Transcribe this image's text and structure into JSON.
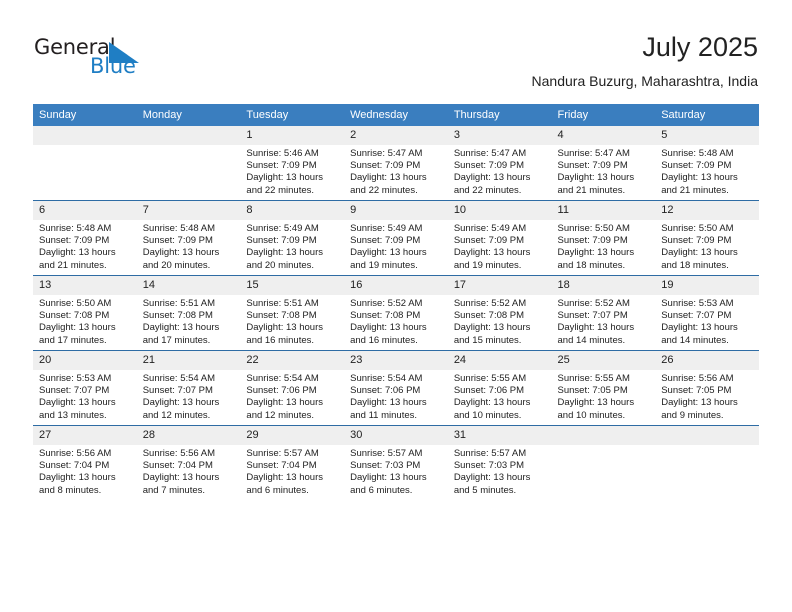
{
  "brand": {
    "name_part1": "General",
    "name_part2": "Blue",
    "triangle_color": "#1f7ec4",
    "text_color": "#231f20"
  },
  "header": {
    "month_title": "July 2025",
    "location": "Nandura Buzurg, Maharashtra, India"
  },
  "theme": {
    "header_blue": "#3a7ebf",
    "row_divider_blue": "#2e6ca4",
    "daynum_band": "#efefef",
    "text": "#222222"
  },
  "weekdays": [
    "Sunday",
    "Monday",
    "Tuesday",
    "Wednesday",
    "Thursday",
    "Friday",
    "Saturday"
  ],
  "weeks": [
    [
      {
        "day": "",
        "sunrise": "",
        "sunset": "",
        "daylight_line1": "",
        "daylight_line2": "",
        "blank": true
      },
      {
        "day": "",
        "sunrise": "",
        "sunset": "",
        "daylight_line1": "",
        "daylight_line2": "",
        "blank": true
      },
      {
        "day": "1",
        "sunrise": "Sunrise: 5:46 AM",
        "sunset": "Sunset: 7:09 PM",
        "daylight_line1": "Daylight: 13 hours",
        "daylight_line2": "and 22 minutes."
      },
      {
        "day": "2",
        "sunrise": "Sunrise: 5:47 AM",
        "sunset": "Sunset: 7:09 PM",
        "daylight_line1": "Daylight: 13 hours",
        "daylight_line2": "and 22 minutes."
      },
      {
        "day": "3",
        "sunrise": "Sunrise: 5:47 AM",
        "sunset": "Sunset: 7:09 PM",
        "daylight_line1": "Daylight: 13 hours",
        "daylight_line2": "and 22 minutes."
      },
      {
        "day": "4",
        "sunrise": "Sunrise: 5:47 AM",
        "sunset": "Sunset: 7:09 PM",
        "daylight_line1": "Daylight: 13 hours",
        "daylight_line2": "and 21 minutes."
      },
      {
        "day": "5",
        "sunrise": "Sunrise: 5:48 AM",
        "sunset": "Sunset: 7:09 PM",
        "daylight_line1": "Daylight: 13 hours",
        "daylight_line2": "and 21 minutes."
      }
    ],
    [
      {
        "day": "6",
        "sunrise": "Sunrise: 5:48 AM",
        "sunset": "Sunset: 7:09 PM",
        "daylight_line1": "Daylight: 13 hours",
        "daylight_line2": "and 21 minutes."
      },
      {
        "day": "7",
        "sunrise": "Sunrise: 5:48 AM",
        "sunset": "Sunset: 7:09 PM",
        "daylight_line1": "Daylight: 13 hours",
        "daylight_line2": "and 20 minutes."
      },
      {
        "day": "8",
        "sunrise": "Sunrise: 5:49 AM",
        "sunset": "Sunset: 7:09 PM",
        "daylight_line1": "Daylight: 13 hours",
        "daylight_line2": "and 20 minutes."
      },
      {
        "day": "9",
        "sunrise": "Sunrise: 5:49 AM",
        "sunset": "Sunset: 7:09 PM",
        "daylight_line1": "Daylight: 13 hours",
        "daylight_line2": "and 19 minutes."
      },
      {
        "day": "10",
        "sunrise": "Sunrise: 5:49 AM",
        "sunset": "Sunset: 7:09 PM",
        "daylight_line1": "Daylight: 13 hours",
        "daylight_line2": "and 19 minutes."
      },
      {
        "day": "11",
        "sunrise": "Sunrise: 5:50 AM",
        "sunset": "Sunset: 7:09 PM",
        "daylight_line1": "Daylight: 13 hours",
        "daylight_line2": "and 18 minutes."
      },
      {
        "day": "12",
        "sunrise": "Sunrise: 5:50 AM",
        "sunset": "Sunset: 7:09 PM",
        "daylight_line1": "Daylight: 13 hours",
        "daylight_line2": "and 18 minutes."
      }
    ],
    [
      {
        "day": "13",
        "sunrise": "Sunrise: 5:50 AM",
        "sunset": "Sunset: 7:08 PM",
        "daylight_line1": "Daylight: 13 hours",
        "daylight_line2": "and 17 minutes."
      },
      {
        "day": "14",
        "sunrise": "Sunrise: 5:51 AM",
        "sunset": "Sunset: 7:08 PM",
        "daylight_line1": "Daylight: 13 hours",
        "daylight_line2": "and 17 minutes."
      },
      {
        "day": "15",
        "sunrise": "Sunrise: 5:51 AM",
        "sunset": "Sunset: 7:08 PM",
        "daylight_line1": "Daylight: 13 hours",
        "daylight_line2": "and 16 minutes."
      },
      {
        "day": "16",
        "sunrise": "Sunrise: 5:52 AM",
        "sunset": "Sunset: 7:08 PM",
        "daylight_line1": "Daylight: 13 hours",
        "daylight_line2": "and 16 minutes."
      },
      {
        "day": "17",
        "sunrise": "Sunrise: 5:52 AM",
        "sunset": "Sunset: 7:08 PM",
        "daylight_line1": "Daylight: 13 hours",
        "daylight_line2": "and 15 minutes."
      },
      {
        "day": "18",
        "sunrise": "Sunrise: 5:52 AM",
        "sunset": "Sunset: 7:07 PM",
        "daylight_line1": "Daylight: 13 hours",
        "daylight_line2": "and 14 minutes."
      },
      {
        "day": "19",
        "sunrise": "Sunrise: 5:53 AM",
        "sunset": "Sunset: 7:07 PM",
        "daylight_line1": "Daylight: 13 hours",
        "daylight_line2": "and 14 minutes."
      }
    ],
    [
      {
        "day": "20",
        "sunrise": "Sunrise: 5:53 AM",
        "sunset": "Sunset: 7:07 PM",
        "daylight_line1": "Daylight: 13 hours",
        "daylight_line2": "and 13 minutes."
      },
      {
        "day": "21",
        "sunrise": "Sunrise: 5:54 AM",
        "sunset": "Sunset: 7:07 PM",
        "daylight_line1": "Daylight: 13 hours",
        "daylight_line2": "and 12 minutes."
      },
      {
        "day": "22",
        "sunrise": "Sunrise: 5:54 AM",
        "sunset": "Sunset: 7:06 PM",
        "daylight_line1": "Daylight: 13 hours",
        "daylight_line2": "and 12 minutes."
      },
      {
        "day": "23",
        "sunrise": "Sunrise: 5:54 AM",
        "sunset": "Sunset: 7:06 PM",
        "daylight_line1": "Daylight: 13 hours",
        "daylight_line2": "and 11 minutes."
      },
      {
        "day": "24",
        "sunrise": "Sunrise: 5:55 AM",
        "sunset": "Sunset: 7:06 PM",
        "daylight_line1": "Daylight: 13 hours",
        "daylight_line2": "and 10 minutes."
      },
      {
        "day": "25",
        "sunrise": "Sunrise: 5:55 AM",
        "sunset": "Sunset: 7:05 PM",
        "daylight_line1": "Daylight: 13 hours",
        "daylight_line2": "and 10 minutes."
      },
      {
        "day": "26",
        "sunrise": "Sunrise: 5:56 AM",
        "sunset": "Sunset: 7:05 PM",
        "daylight_line1": "Daylight: 13 hours",
        "daylight_line2": "and 9 minutes."
      }
    ],
    [
      {
        "day": "27",
        "sunrise": "Sunrise: 5:56 AM",
        "sunset": "Sunset: 7:04 PM",
        "daylight_line1": "Daylight: 13 hours",
        "daylight_line2": "and 8 minutes."
      },
      {
        "day": "28",
        "sunrise": "Sunrise: 5:56 AM",
        "sunset": "Sunset: 7:04 PM",
        "daylight_line1": "Daylight: 13 hours",
        "daylight_line2": "and 7 minutes."
      },
      {
        "day": "29",
        "sunrise": "Sunrise: 5:57 AM",
        "sunset": "Sunset: 7:04 PM",
        "daylight_line1": "Daylight: 13 hours",
        "daylight_line2": "and 6 minutes."
      },
      {
        "day": "30",
        "sunrise": "Sunrise: 5:57 AM",
        "sunset": "Sunset: 7:03 PM",
        "daylight_line1": "Daylight: 13 hours",
        "daylight_line2": "and 6 minutes."
      },
      {
        "day": "31",
        "sunrise": "Sunrise: 5:57 AM",
        "sunset": "Sunset: 7:03 PM",
        "daylight_line1": "Daylight: 13 hours",
        "daylight_line2": "and 5 minutes."
      },
      {
        "day": "",
        "sunrise": "",
        "sunset": "",
        "daylight_line1": "",
        "daylight_line2": "",
        "blank": true
      },
      {
        "day": "",
        "sunrise": "",
        "sunset": "",
        "daylight_line1": "",
        "daylight_line2": "",
        "blank": true
      }
    ]
  ]
}
